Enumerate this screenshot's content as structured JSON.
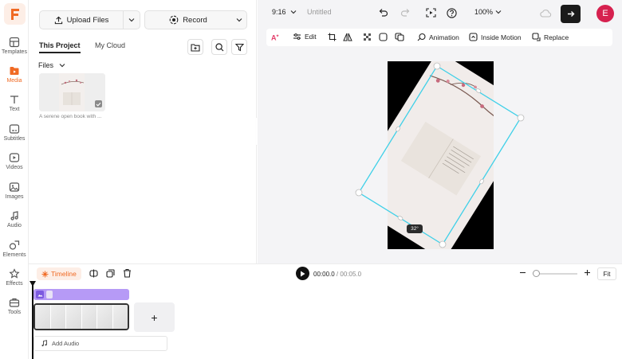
{
  "nav": {
    "items": [
      {
        "label": "Templates"
      },
      {
        "label": "Media"
      },
      {
        "label": "Text"
      },
      {
        "label": "Subtitles"
      },
      {
        "label": "Videos"
      },
      {
        "label": "Images"
      },
      {
        "label": "Audio"
      },
      {
        "label": "Elements"
      },
      {
        "label": "Effects"
      },
      {
        "label": "Tools"
      }
    ],
    "active": "Media",
    "accent": "#f06a24"
  },
  "panel": {
    "upload_label": "Upload Files",
    "record_label": "Record",
    "tabs": [
      {
        "label": "This Project"
      },
      {
        "label": "My Cloud"
      }
    ],
    "files_label": "Files",
    "file_caption": "A serene open book with ..."
  },
  "editor": {
    "aspect_ratio": "9:16",
    "project_title": "Untitled",
    "zoom": "100%",
    "avatar_letter": "E",
    "toolbar": {
      "edit_label": "Edit",
      "animation_label": "Animation",
      "inside_motion_label": "Inside Motion",
      "replace_label": "Replace"
    },
    "rotation_readout": "32°"
  },
  "timeline": {
    "label": "Timeline",
    "current_time": "00:00.0",
    "separator": " / ",
    "total_time": "00:05.0",
    "fit_label": "Fit",
    "add_audio_label": "Add Audio",
    "add_track_symbol": "+"
  }
}
